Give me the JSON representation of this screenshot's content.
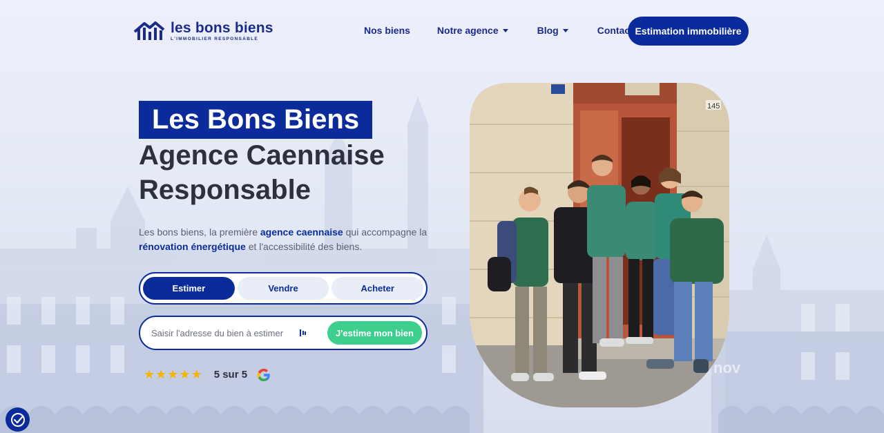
{
  "brand": {
    "name": "les bons biens",
    "tagline": "L'IMMOBILIER RESPONSABLE",
    "primary_color": "#0c2b9b",
    "accent_color": "#3ecf8e"
  },
  "nav": {
    "items": [
      {
        "label": "Nos biens",
        "dropdown": false
      },
      {
        "label": "Notre agence",
        "dropdown": true
      },
      {
        "label": "Blog",
        "dropdown": true
      },
      {
        "label": "Contact",
        "dropdown": false
      }
    ],
    "cta_label": "Estimation immobilière"
  },
  "hero": {
    "badge": "Les Bons Biens",
    "line1": "Agence Caennaise",
    "line2": "Responsable",
    "desc_part1": "Les bons biens, la première ",
    "desc_bold1": "agence caennaise",
    "desc_part2": " qui accompagne la ",
    "desc_bold2": "rénovation énergétique",
    "desc_part3": " et l'accessibilité des biens."
  },
  "tabs": [
    {
      "label": "Estimer",
      "active": true
    },
    {
      "label": "Vendre",
      "active": false
    },
    {
      "label": "Acheter",
      "active": false
    }
  ],
  "search": {
    "placeholder": "Saisir l'adresse du bien à estimer",
    "button_label": "J'estime mon bien"
  },
  "rating": {
    "stars": 5,
    "text": "5 sur 5",
    "icon": "google-icon"
  },
  "photo": {
    "door_number": "145",
    "watermark": "nov"
  },
  "cookie_icon": "cookie-consent-icon"
}
